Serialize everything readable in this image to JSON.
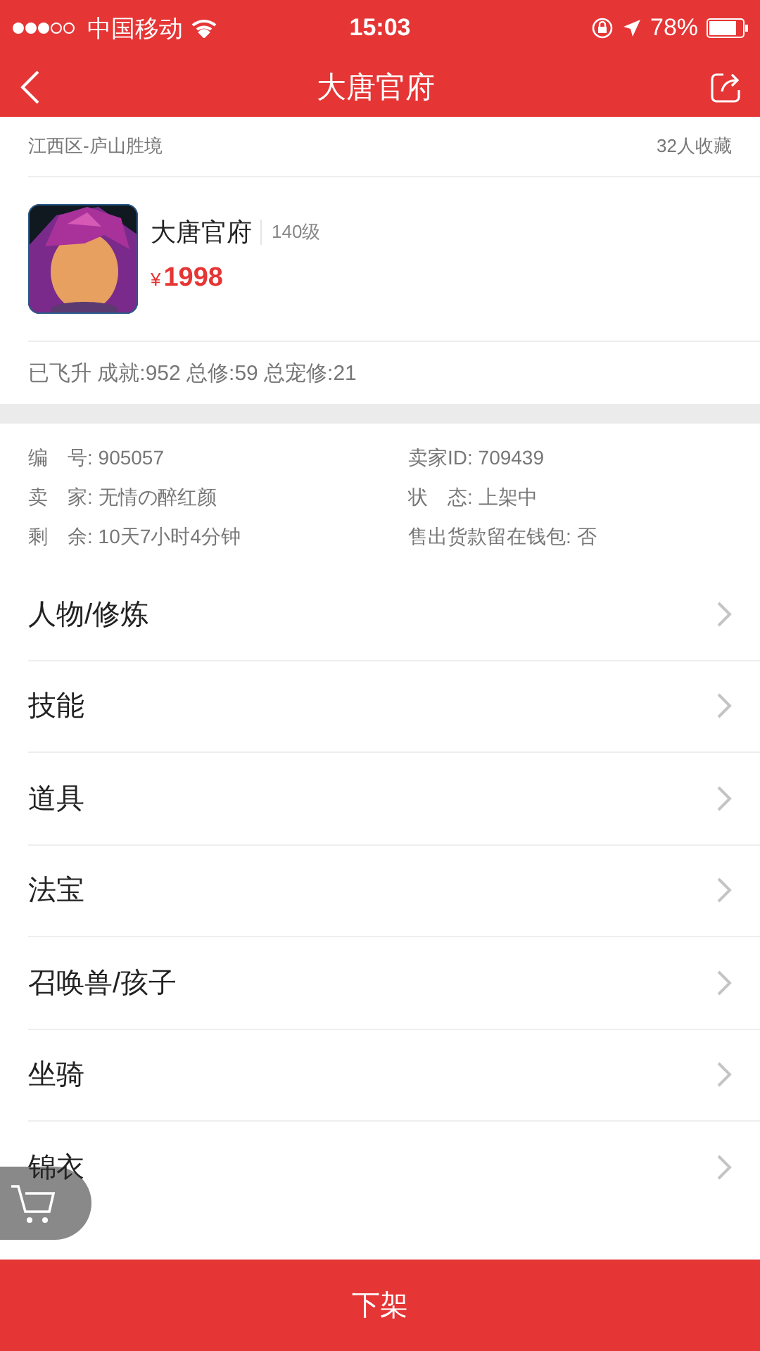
{
  "status_bar": {
    "carrier": "中国移动",
    "time": "15:03",
    "battery": "78%"
  },
  "nav": {
    "title": "大唐官府"
  },
  "listing": {
    "server": "江西区-庐山胜境",
    "favorites": "32人收藏",
    "name": "大唐官府",
    "level": "140级",
    "price_symbol": "¥",
    "price": "1998",
    "summary": "已飞升 成就:952 总修:59 总宠修:21"
  },
  "details": [
    {
      "label": "编　号:",
      "value": "905057"
    },
    {
      "label": "卖家ID:",
      "value": "709439"
    },
    {
      "label": "卖　家:",
      "value": "无情の醉红颜"
    },
    {
      "label": "状　态:",
      "value": "上架中"
    },
    {
      "label": "剩　余:",
      "value": "10天7小时4分钟"
    },
    {
      "label": "售出货款留在钱包:",
      "value": "否"
    }
  ],
  "menu": [
    {
      "label": "人物/修炼"
    },
    {
      "label": "技能"
    },
    {
      "label": "道具"
    },
    {
      "label": "法宝"
    },
    {
      "label": "召唤兽/孩子"
    },
    {
      "label": "坐骑"
    },
    {
      "label": "锦衣"
    }
  ],
  "action": {
    "label": "下架"
  }
}
